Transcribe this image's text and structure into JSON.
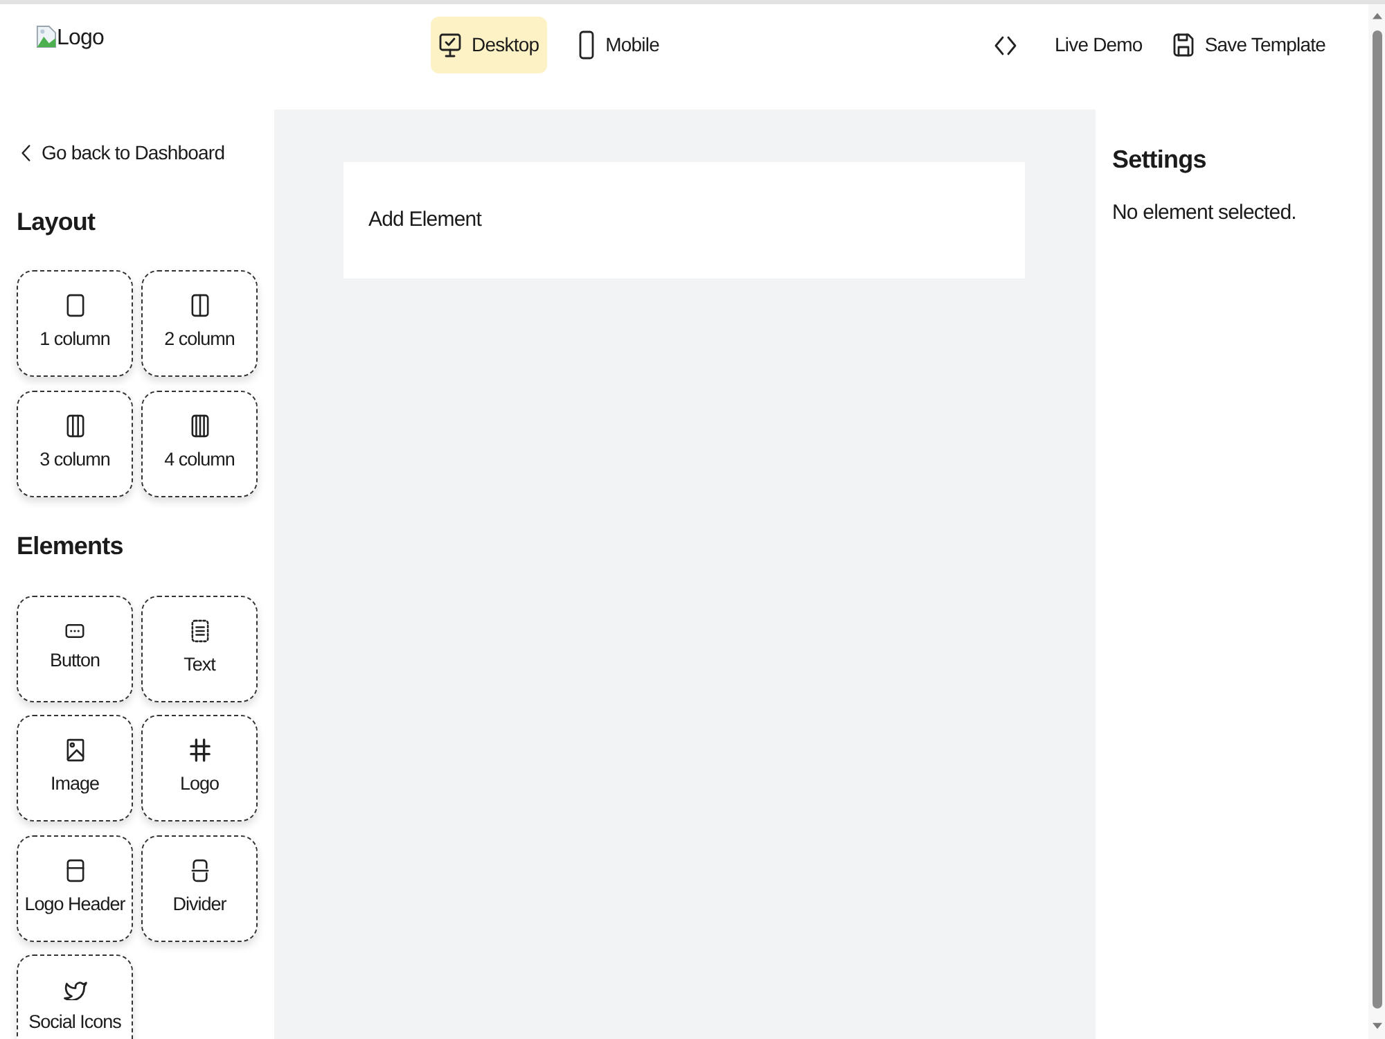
{
  "header": {
    "logo_alt": "Logo",
    "view_modes": [
      {
        "label": "Desktop",
        "kind": "desktop",
        "selected": true
      },
      {
        "label": "Mobile",
        "kind": "mobile",
        "selected": false
      }
    ],
    "actions": [
      {
        "kind": "code"
      },
      {
        "kind": "link",
        "label": "Live Demo"
      },
      {
        "kind": "save",
        "label": "Save Template"
      }
    ]
  },
  "sidebar": {
    "back_link": "Go back to Dashboard",
    "sections": [
      {
        "title": "Layout",
        "items": [
          {
            "label": "1 column",
            "kind": "one-column"
          },
          {
            "label": "2 column",
            "kind": "two-column"
          },
          {
            "label": "3 column",
            "kind": "three-column"
          },
          {
            "label": "4 column",
            "kind": "four-column"
          }
        ]
      },
      {
        "title": "Elements",
        "items": [
          {
            "label": "Button",
            "kind": "button"
          },
          {
            "label": "Text",
            "kind": "text"
          },
          {
            "label": "Image",
            "kind": "image"
          },
          {
            "label": "Logo",
            "kind": "logo"
          },
          {
            "label": "Logo Header",
            "kind": "logo-header"
          },
          {
            "label": "Divider",
            "kind": "divider"
          },
          {
            "label": "Social Icons",
            "kind": "social"
          }
        ]
      }
    ]
  },
  "canvas": {
    "blocks": [
      {
        "label": "Add Element"
      }
    ]
  },
  "settings": {
    "title": "Settings",
    "message": "No element selected."
  }
}
